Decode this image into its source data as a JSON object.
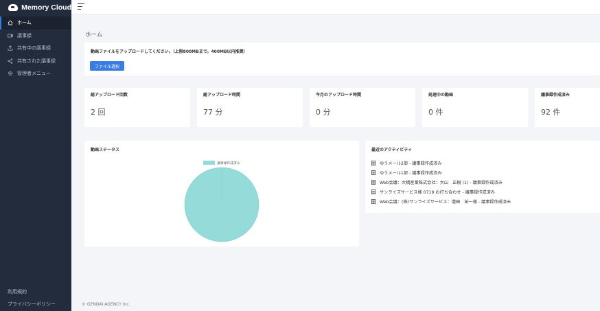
{
  "app": {
    "title": "Memory Cloud"
  },
  "sidebar": {
    "items": [
      {
        "label": "ホーム",
        "icon": "home-icon",
        "active": true
      },
      {
        "label": "議事録",
        "icon": "video-icon",
        "active": false
      },
      {
        "label": "共有中の議事録",
        "icon": "upload-icon",
        "active": false
      },
      {
        "label": "共有された議事録",
        "icon": "share-icon",
        "active": false
      },
      {
        "label": "管理者メニュー",
        "icon": "gear-icon",
        "active": false
      }
    ],
    "footer": {
      "terms": "利用規約",
      "privacy": "プライバシーポリシー"
    }
  },
  "page": {
    "title": "ホーム"
  },
  "upload": {
    "instruction": "動画ファイルをアップロードしてください。（上限800MBまで。400MB以内推奨）",
    "button_label": "ファイル選択"
  },
  "stats": [
    {
      "label": "総アップロード回数",
      "value": "2 回"
    },
    {
      "label": "総アップロード時間",
      "value": "77 分"
    },
    {
      "label": "今月のアップロード時間",
      "value": "0 分"
    },
    {
      "label": "処理中の動画",
      "value": "0 件"
    },
    {
      "label": "議事録作成済み",
      "value": "92 件"
    }
  ],
  "chart_data": {
    "type": "pie",
    "title": "動画ステータス",
    "categories": [
      "議事録作成済み"
    ],
    "values": [
      100
    ],
    "colors": [
      "#94dbd9"
    ],
    "legend": "top"
  },
  "activity": {
    "title": "最近のアクティビティ",
    "items": [
      "ゆうメール2部 - 議事録作成済み",
      "ゆうメール1部 - 議事録作成済み",
      "Web会議：大橋産業株式会社：大山　正樹 (1) - 議事録作成済み",
      "サンライズサービス様 0719 お打ち合わせ - 議事録作成済み",
      "Web会議：(株)サンライズサービス：増田　祐一様 - 議事録作成済み"
    ]
  },
  "footer": {
    "copyright": "© GENDAI AGENCY Inc."
  },
  "colors": {
    "sidebar": "#232c3d",
    "accent": "#3a7de0",
    "pie": "#94dbd9"
  }
}
